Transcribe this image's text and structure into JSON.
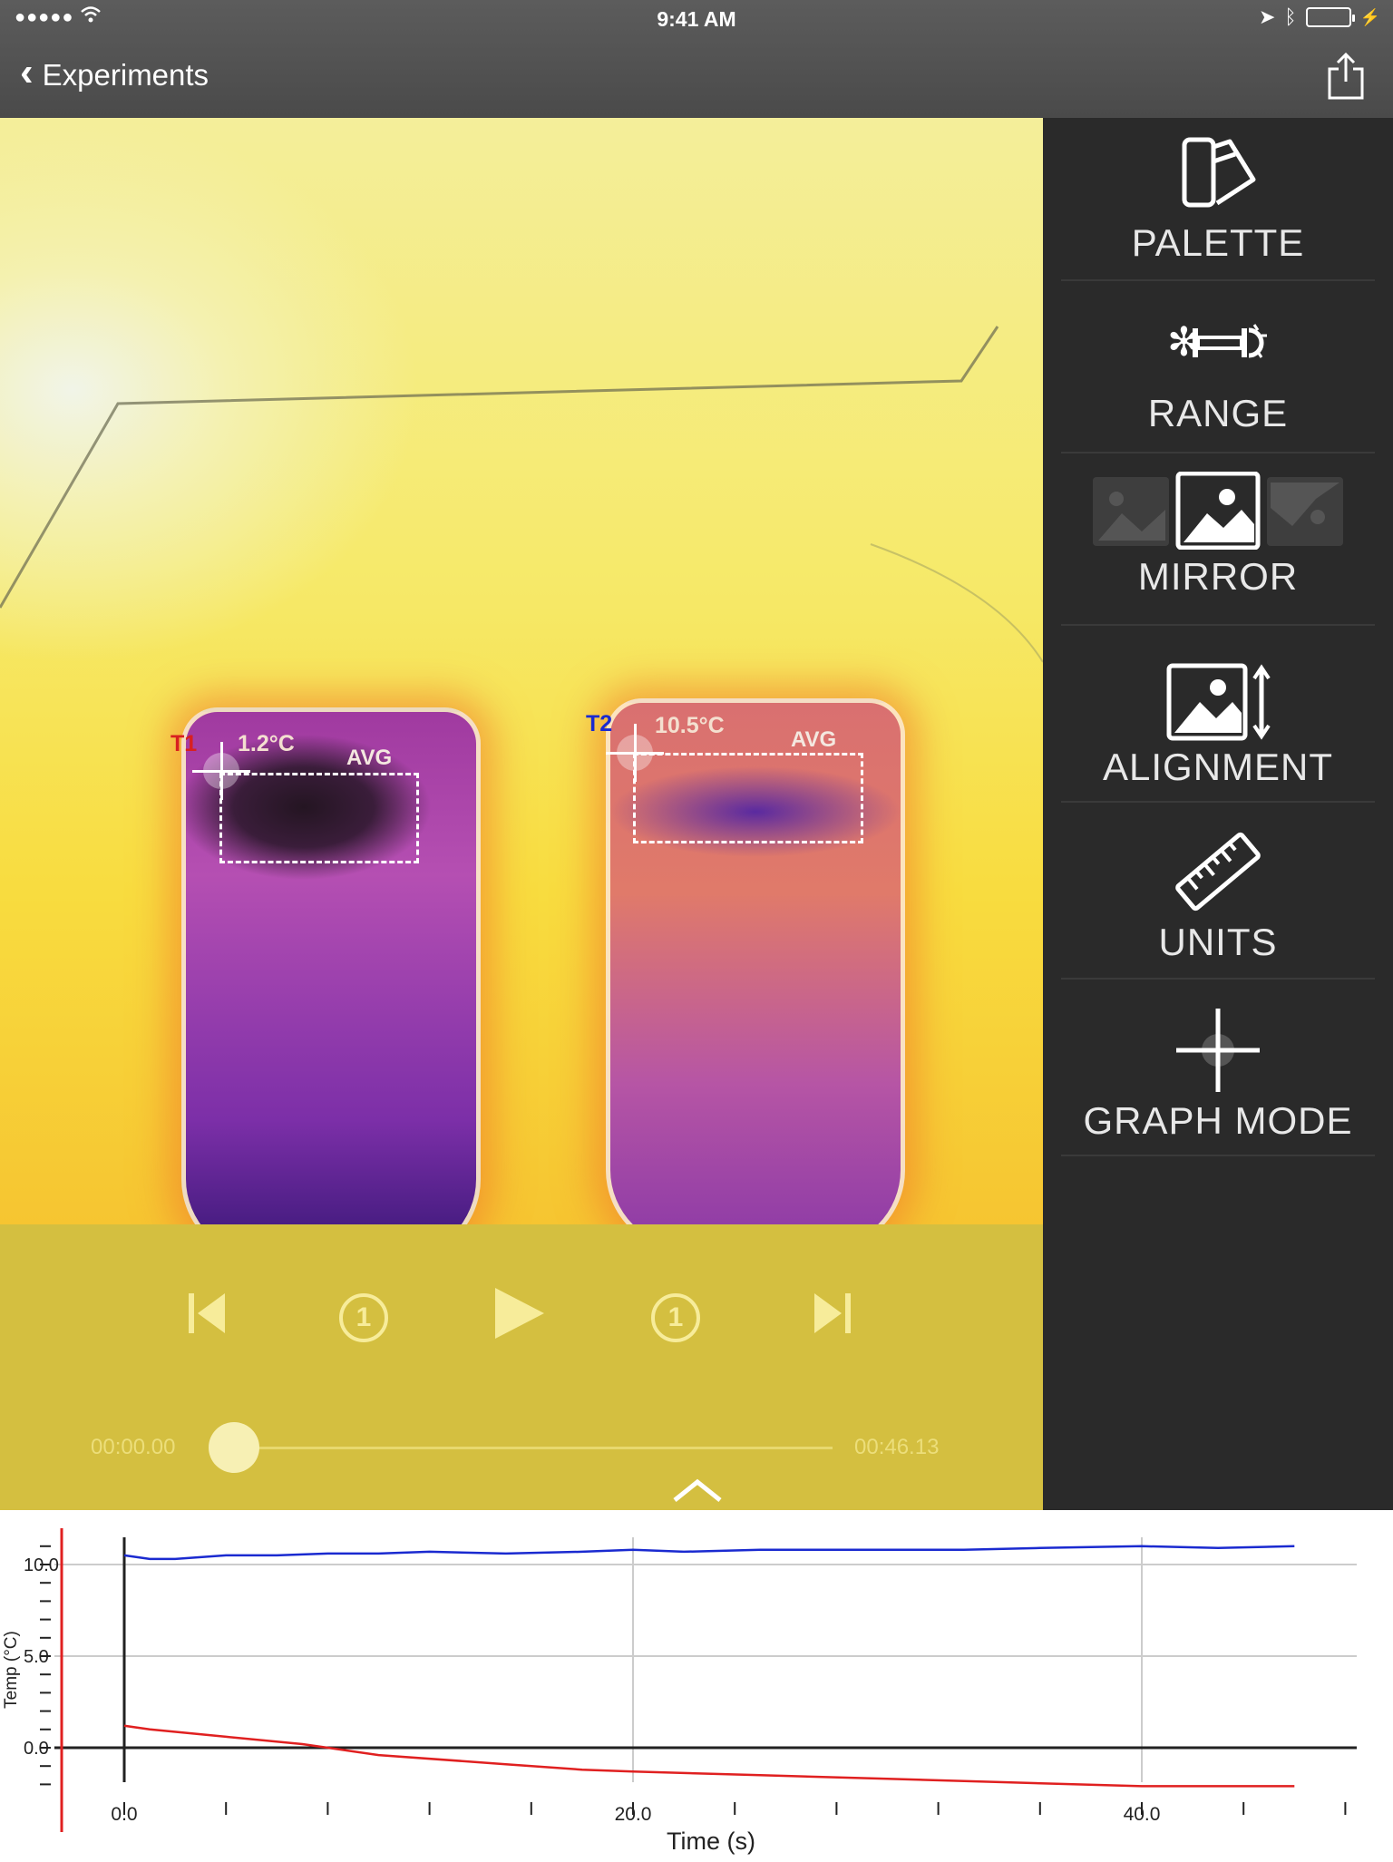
{
  "status_bar": {
    "time": "9:41 AM",
    "signal": "●●●●●"
  },
  "nav": {
    "back_label": "Experiments"
  },
  "thermal": {
    "probe1": {
      "label": "T1",
      "temp": "1.2°C",
      "avg": "AVG"
    },
    "probe2": {
      "label": "T2",
      "temp": "10.5°C",
      "avg": "AVG"
    }
  },
  "playback": {
    "current_time": "00:00.00",
    "end_time": "00:46.13",
    "progress": 0
  },
  "sidebar": {
    "palette": "PALETTE",
    "range": "RANGE",
    "mirror": "MIRROR",
    "alignment": "ALIGNMENT",
    "units": "UNITS",
    "graph_mode": "GRAPH MODE"
  },
  "colors": {
    "t1": "#e02020",
    "t2": "#1a2ad0"
  },
  "chart_data": {
    "type": "line",
    "xlabel": "Time (s)",
    "ylabel": "Temp (°C)",
    "xlim": [
      0,
      48
    ],
    "ylim": [
      -3,
      11
    ],
    "x_tick_labels": [
      "0.0",
      "20.0",
      "40.0"
    ],
    "y_tick_labels": [
      "10.0",
      "5.0",
      "0.0"
    ],
    "series": [
      {
        "name": "T2",
        "color": "#1a2ad0",
        "x": [
          0,
          1,
          2,
          4,
          6,
          8,
          10,
          12,
          15,
          18,
          20,
          22,
          25,
          28,
          30,
          33,
          36,
          40,
          43,
          46
        ],
        "y": [
          10.5,
          10.3,
          10.3,
          10.5,
          10.5,
          10.6,
          10.6,
          10.7,
          10.6,
          10.7,
          10.8,
          10.7,
          10.8,
          10.8,
          10.8,
          10.8,
          10.9,
          11.0,
          10.9,
          11.0
        ]
      },
      {
        "name": "T1",
        "color": "#e02020",
        "x": [
          0,
          1,
          4,
          7,
          8,
          10,
          15,
          18,
          20,
          25,
          30,
          35,
          40,
          43,
          46
        ],
        "y": [
          1.2,
          1.0,
          0.6,
          0.2,
          0.0,
          -0.4,
          -0.9,
          -1.2,
          -1.3,
          -1.5,
          -1.7,
          -1.9,
          -2.1,
          -2.1,
          -2.1
        ]
      }
    ]
  }
}
